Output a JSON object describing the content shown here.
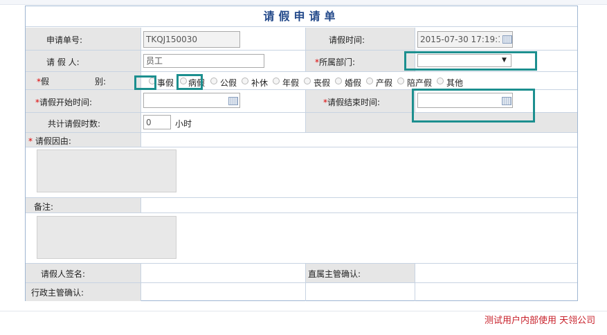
{
  "form": {
    "title": "请假申请单",
    "app_no_label": "申请单号:",
    "app_no_value": "TKQJ150030",
    "leave_time_label": "请假时间:",
    "leave_time_value": "2015-07-30 17:19:11",
    "applicant_label": "请 假 人:",
    "applicant_value": "员工",
    "dept_label": "所属部门:",
    "dept_value": "",
    "type_label_a": "假",
    "type_label_b": "别:",
    "required_mark": "*",
    "leave_types": [
      "事假",
      "病假",
      "公假",
      "补休",
      "年假",
      "丧假",
      "婚假",
      "产假",
      "陪产假",
      "其他"
    ],
    "start_label": "请假开始时间:",
    "end_label": "请假结束时间:",
    "total_label": "共计请假时数:",
    "total_value": "0",
    "total_unit": "小时",
    "reason_label": "请假因由:",
    "remark_label": "备注:",
    "signature_label": "请假人签名:",
    "supervisor_label": "直属主管确认:",
    "admin_label": "行政主管确认:"
  },
  "footer": {
    "text": "测试用户内部使用 天翎公司"
  },
  "colors": {
    "highlight": "#1c8f8f",
    "title": "#23498a",
    "footer": "#c8202a"
  }
}
